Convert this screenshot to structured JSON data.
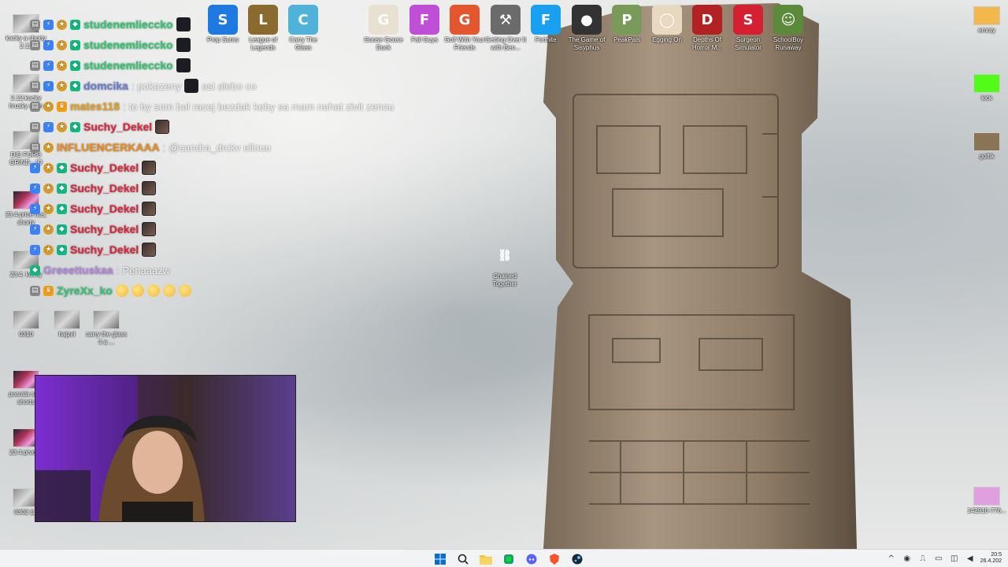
{
  "desktop_left": [
    {
      "label": "kacky a shorty 2.12",
      "kind": "thumb"
    },
    {
      "label": "2.12.kacky hrusky aplin",
      "kind": "thumb"
    },
    {
      "label": "DIE FORG GRIND - (O",
      "kind": "thumb"
    },
    {
      "label": "23.4.price hus, shorty",
      "kind": "vid"
    },
    {
      "label": "23.4. kacky",
      "kind": "thumb"
    },
    {
      "label": "0310",
      "kind": "thumb"
    },
    {
      "label": "hajzel",
      "kind": "thumb"
    },
    {
      "label": "carry the glass 4 a ...",
      "kind": "thumb"
    },
    {
      "label": "posrala sa + shorts",
      "kind": "vid"
    },
    {
      "label": "23.4.prvosp",
      "kind": "vid"
    },
    {
      "label": "0302 (1)",
      "kind": "thumb"
    }
  ],
  "desktop_top": [
    {
      "label": "Prop Sumo",
      "color": "#1f7ae0",
      "glyph": "S"
    },
    {
      "label": "League of Legends",
      "color": "#8a6a2e",
      "glyph": "L"
    },
    {
      "label": "Carry The Glass",
      "color": "#4fb3d9",
      "glyph": "C"
    },
    {
      "label": "Goose Goose Duck",
      "color": "#e8e0d0",
      "glyph": "G"
    },
    {
      "label": "Fall Guys",
      "color": "#c04fd8",
      "glyph": "F"
    },
    {
      "label": "Golf With Your Friends",
      "color": "#e4572e",
      "glyph": "G"
    },
    {
      "label": "Getting Over It with Ben...",
      "color": "#6b6b6b",
      "glyph": "⚒"
    },
    {
      "label": "Fortnite",
      "color": "#1aa0f0",
      "glyph": "F"
    },
    {
      "label": "The Game of Sisyphus",
      "color": "#333333",
      "glyph": "●"
    },
    {
      "label": "PeakPals",
      "color": "#7a9a5a",
      "glyph": "P"
    },
    {
      "label": "Egging On",
      "color": "#e9d8c0",
      "glyph": "◯"
    },
    {
      "label": "Depths Of Horror M...",
      "color": "#b22222",
      "glyph": "D"
    },
    {
      "label": "Surgeon Simulator",
      "color": "#d42030",
      "glyph": "S"
    },
    {
      "label": "SchoolBoy Runaway",
      "color": "#5a8a3a",
      "glyph": "☺"
    }
  ],
  "desktop_right": [
    {
      "label": "emoty",
      "color": "#f2b84b"
    },
    {
      "label": "kick",
      "color": "#53fc18"
    },
    {
      "label": "golfik",
      "color": "#8b7355"
    },
    {
      "label": "142910-776...",
      "color": "#e0a0e0"
    }
  ],
  "desktop_middle": {
    "label": "Chained Together",
    "color": "#b32424"
  },
  "chat": [
    {
      "user": "studenemlieccko",
      "color": "#2ecc71",
      "msg": "",
      "badges": [
        "gray",
        "blue",
        "gold",
        "green"
      ],
      "emotes": [
        "dark"
      ]
    },
    {
      "user": "studenemlieccko",
      "color": "#2ecc71",
      "msg": "",
      "badges": [
        "gray",
        "blue",
        "gold",
        "green"
      ],
      "emotes": [
        "dark"
      ]
    },
    {
      "user": "studenemlieccko",
      "color": "#2ecc71",
      "msg": "",
      "badges": [
        "gray",
        "blue",
        "gold",
        "green"
      ],
      "emotes": [
        "dark"
      ]
    },
    {
      "user": "domcika",
      "color": "#6b7fd7",
      "msg": "pokazeny",
      "after": "asi alebo co",
      "badges": [
        "gray",
        "blue",
        "gold",
        "green"
      ],
      "emotes": [
        "dark"
      ]
    },
    {
      "user": "mates118",
      "color": "#e8a020",
      "msg": "to by som bol racej bezdak keby sa mam nehat zivit zenou",
      "badges": [
        "gray",
        "gold",
        "orange"
      ],
      "emotes": []
    },
    {
      "user": "Suchy_Dekel",
      "color": "#e0243c",
      "msg": "",
      "badges": [
        "gray",
        "blue",
        "gold",
        "green"
      ],
      "emotes": [
        "face"
      ]
    },
    {
      "user": "INFLUENCERKAAA",
      "color": "#f08c1a",
      "msg": "@sandra_drckv ellouu",
      "badges": [
        "gray",
        "gold"
      ],
      "emotes": []
    },
    {
      "user": "Suchy_Dekel",
      "color": "#e0243c",
      "msg": "",
      "badges": [
        "blue",
        "gold",
        "green"
      ],
      "emotes": [
        "face"
      ]
    },
    {
      "user": "Suchy_Dekel",
      "color": "#e0243c",
      "msg": "",
      "badges": [
        "blue",
        "gold",
        "green"
      ],
      "emotes": [
        "face"
      ]
    },
    {
      "user": "Suchy_Dekel",
      "color": "#e0243c",
      "msg": "",
      "badges": [
        "blue",
        "gold",
        "green"
      ],
      "emotes": [
        "face"
      ]
    },
    {
      "user": "Suchy_Dekel",
      "color": "#e0243c",
      "msg": "",
      "badges": [
        "blue",
        "gold",
        "green"
      ],
      "emotes": [
        "face"
      ]
    },
    {
      "user": "Suchy_Dekel",
      "color": "#e0243c",
      "msg": "",
      "badges": [
        "blue",
        "gold",
        "green"
      ],
      "emotes": [
        "face"
      ]
    },
    {
      "user": "Greeettuskaa",
      "color": "#b88ae8",
      "msg": "Penaaazw",
      "badges": [
        "green"
      ],
      "emotes": []
    },
    {
      "user": "ZyreXx_ko",
      "color": "#2ecc71",
      "msg": "",
      "badges": [
        "gray",
        "orange"
      ],
      "emotes": [],
      "emojis": 5
    }
  ],
  "taskbar": {
    "apps": [
      "start-icon",
      "search-icon",
      "file-explorer-icon",
      "app-green-icon",
      "discord-icon",
      "brave-icon",
      "steam-icon"
    ],
    "clock_time": "20:5",
    "clock_date": "26.4.202"
  }
}
